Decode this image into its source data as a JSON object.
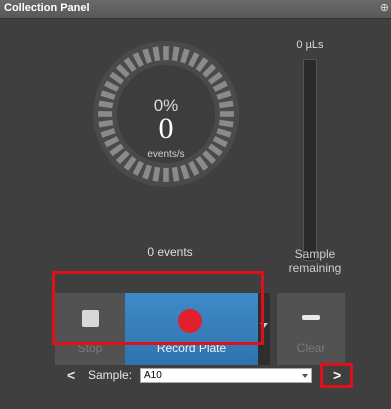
{
  "title": "Collection Panel",
  "pin_icon": "pin-icon",
  "gauge": {
    "percent_text": "0%",
    "rate_value": "0",
    "rate_unit": "events/s",
    "progress_fraction": 0
  },
  "volume": {
    "label": "0 µLs",
    "fill_fraction": 0,
    "caption": "Sample remaining"
  },
  "events_text": "0 events",
  "buttons": {
    "stop": "Stop",
    "record": "Record Plate",
    "clear": "Clear"
  },
  "sample": {
    "label": "Sample:",
    "value": "A10"
  },
  "colors": {
    "record_blue": "#3a83c0",
    "record_dot": "#e0202a",
    "highlight": "#e0101a",
    "background": "#3f3f3f"
  }
}
